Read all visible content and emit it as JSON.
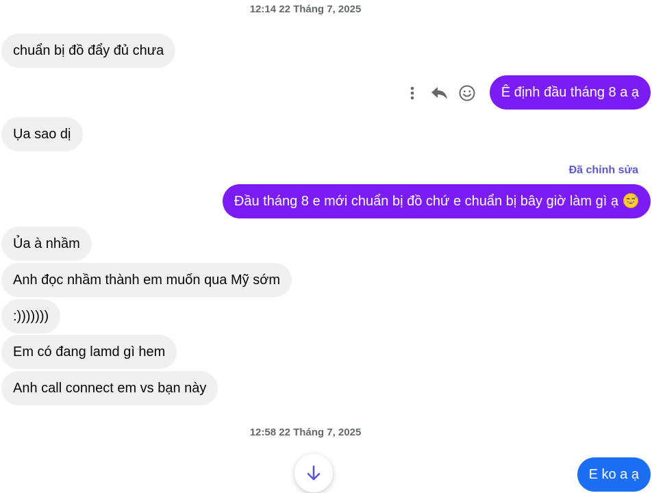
{
  "timestamps": {
    "first": "12:14 22 Tháng 7, 2025",
    "second": "12:58 22 Tháng 7, 2025"
  },
  "messages": {
    "m1": "chuẩn bị đồ đẩy đủ chưa",
    "m2": "Ê định đầu tháng 8 a ạ",
    "m3": "Ụa sao dị",
    "m4": "Đầu tháng 8 e mới chuẩn bị đồ chứ e chuẩn bị bây giờ làm gì ạ",
    "m5": "Ủa à nhầm",
    "m6": "Anh đọc nhầm thành em muốn qua Mỹ sớm",
    "m7": ":)))))))",
    "m8": "Em có đang lamd gì hem",
    "m9": "Anh call connect em vs bạn này",
    "m10": "E ko a ạ"
  },
  "edited_label": "Đã chỉnh sửa",
  "icons": {
    "more": "more-vertical-icon",
    "reply": "reply-icon",
    "react": "smiley-icon",
    "emoji": "sweat-smile-emoji-icon",
    "scroll": "arrow-down-icon"
  },
  "colors": {
    "outgoing": "#7b1cf4",
    "outgoing_latest": "#1c6ef2",
    "incoming": "#f0f0f0",
    "edited": "#5b57d6",
    "timestamp": "#65676b"
  }
}
